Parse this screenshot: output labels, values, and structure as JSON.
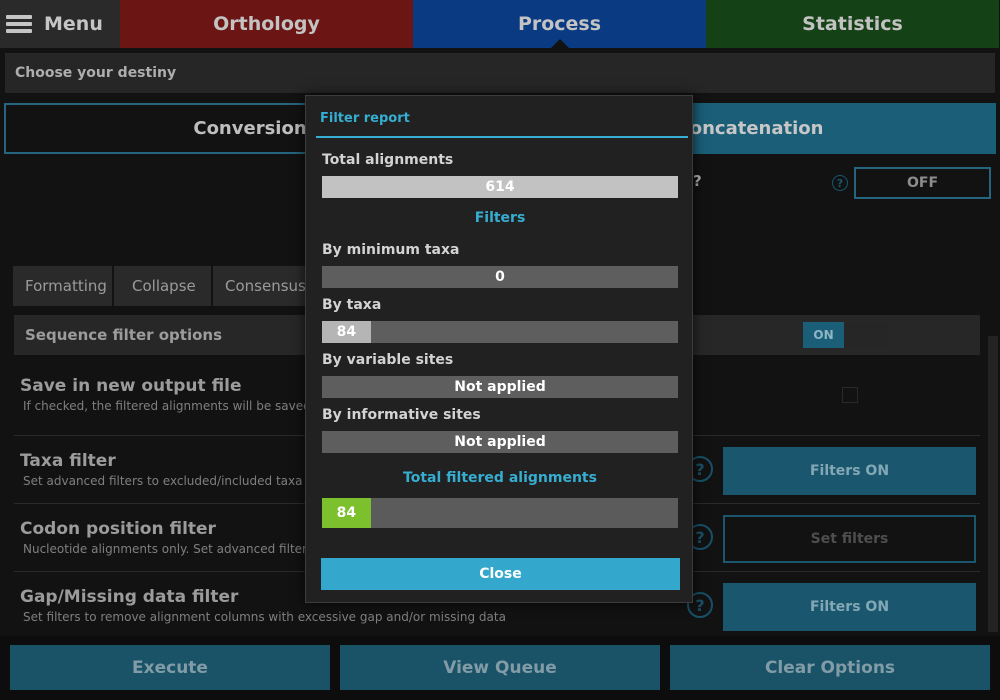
{
  "topbar": {
    "menu_label": "Menu",
    "tabs": [
      {
        "label": "Orthology",
        "color": "#751817"
      },
      {
        "label": "Process",
        "color": "#0b3f8e"
      },
      {
        "label": "Statistics",
        "color": "#174718"
      }
    ]
  },
  "destiny": "Choose your destiny",
  "modes": {
    "conversion": "Conversion",
    "concatenation": "Concatenation"
  },
  "concat_option": {
    "question_fragment": "?",
    "help": "?",
    "toggle": "OFF"
  },
  "subtabs": [
    "Formatting",
    "Collapse",
    "Consensus"
  ],
  "sequence_filter": {
    "header": "Sequence filter options",
    "toggle_on": "ON"
  },
  "options": [
    {
      "title": "Save in new output file",
      "desc": "If checked, the filtered alignments will be saved in"
    },
    {
      "title": "Taxa filter",
      "desc": "Set advanced filters to excluded/included taxa",
      "button": "Filters ON"
    },
    {
      "title": "Codon position filter",
      "desc": "Nucleotide alignments only. Set advanced filters to",
      "button": "Set filters"
    },
    {
      "title": "Gap/Missing data filter",
      "desc": "Set filters to remove alignment columns with excessive gap and/or missing data",
      "button": "Filters ON"
    }
  ],
  "help_glyph": "?",
  "bottom": {
    "execute": "Execute",
    "queue": "View Queue",
    "clear": "Clear Options"
  },
  "modal": {
    "title": "Filter report",
    "total_label": "Total alignments",
    "total_value": "614",
    "filters_heading": "Filters",
    "min_taxa_label": "By minimum taxa",
    "min_taxa_value": "0",
    "by_taxa_label": "By taxa",
    "by_taxa_value": "84",
    "by_taxa_fraction": 0.137,
    "var_sites_label": "By variable sites",
    "var_sites_value": "Not applied",
    "inf_sites_label": "By informative sites",
    "inf_sites_value": "Not applied",
    "total_filtered_heading": "Total filtered alignments",
    "total_filtered_value": "84",
    "total_filtered_fraction": 0.137,
    "close": "Close"
  },
  "colors": {
    "accent": "#36aed2",
    "green": "#7cc02d"
  }
}
